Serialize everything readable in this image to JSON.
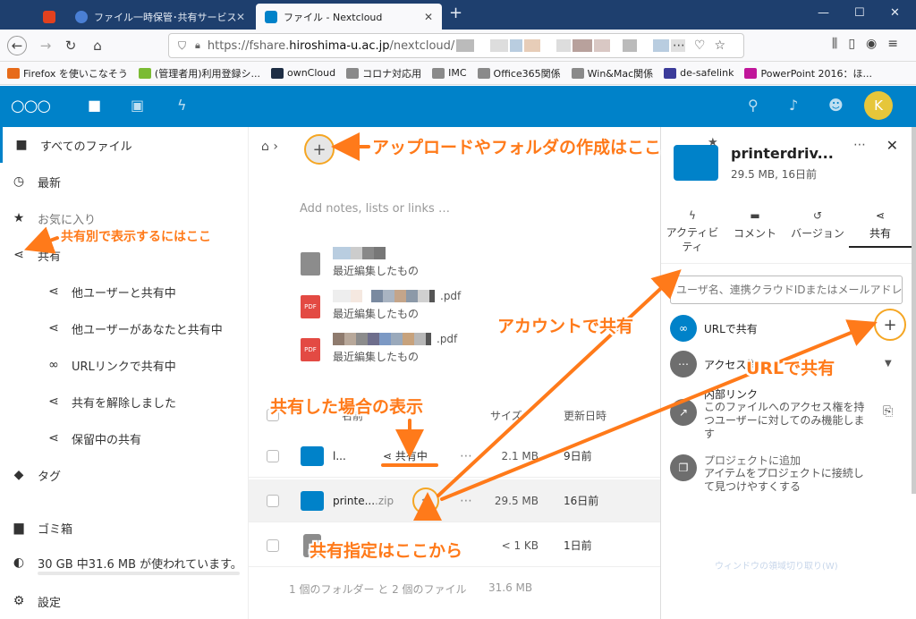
{
  "browser": {
    "tabs": [
      {
        "label": "",
        "color": "#e2411f"
      },
      {
        "label": "ファイル一時保管･共有サービス (N",
        "color": "#4a7fd4"
      },
      {
        "label": "ファイル - Nextcloud",
        "color": "#0082c9"
      }
    ],
    "new_tab": "+",
    "url_host": "https://fshare.",
    "url_domain": "hiroshima-u.ac.jp",
    "url_path": "/nextcloud/",
    "bookmarks": [
      {
        "label": "Firefox を使いこなそう",
        "color": "#e76b1a"
      },
      {
        "label": "(管理者用)利用登録シ...",
        "color": "#7bbb34"
      },
      {
        "label": "ownCloud",
        "color": "#1d2d44"
      },
      {
        "label": "コロナ対応用",
        "color": "#8a8a8a"
      },
      {
        "label": "IMC",
        "color": "#8a8a8a"
      },
      {
        "label": "Office365関係",
        "color": "#8a8a8a"
      },
      {
        "label": "Win&Mac関係",
        "color": "#8a8a8a"
      },
      {
        "label": "de-safelink",
        "color": "#3b3b9a"
      },
      {
        "label": "PowerPoint 2016：ほ...",
        "color": "#c0169a"
      }
    ]
  },
  "header": {
    "logo": "○○○",
    "avatar_letter": "K",
    "brand_color": "#0082c9"
  },
  "sidebar": {
    "items": [
      {
        "label": "すべてのファイル",
        "icon": "folder-icon"
      },
      {
        "label": "最新",
        "icon": "clock-icon"
      },
      {
        "label": "お気に入り",
        "icon": "star-icon"
      },
      {
        "label": "共有",
        "icon": "share-icon"
      },
      {
        "label": "他ユーザーと共有中",
        "icon": "share-icon"
      },
      {
        "label": "他ユーザーがあなたと共有中",
        "icon": "share-icon"
      },
      {
        "label": "URLリンクで共有中",
        "icon": "link-icon"
      },
      {
        "label": "共有を解除しました",
        "icon": "share-icon"
      },
      {
        "label": "保留中の共有",
        "icon": "share-icon"
      },
      {
        "label": "タグ",
        "icon": "tag-icon"
      },
      {
        "label": "ゴミ箱",
        "icon": "trash-icon"
      },
      {
        "label": "30 GB 中31.6 MB が使われています。",
        "icon": "pie-icon"
      },
      {
        "label": "設定",
        "icon": "gear-icon"
      }
    ]
  },
  "main": {
    "notes_placeholder": "Add notes, lists or links …",
    "recent": [
      {
        "ext": "",
        "sub": "最近編集したもの",
        "type": "doc"
      },
      {
        "ext": ".pdf",
        "sub": "最近編集したもの",
        "type": "pdf"
      },
      {
        "ext": ".pdf",
        "sub": "最近編集したもの",
        "type": "pdf"
      }
    ],
    "pdf_label": "PDF",
    "columns": {
      "name": "名前",
      "size": "サイズ",
      "modified": "更新日時"
    },
    "files": [
      {
        "name": "l...",
        "ext": "",
        "shared_label": "共有中",
        "size": "2.1 MB",
        "date": "9日前",
        "type": "folder"
      },
      {
        "name": "printe...",
        "ext": ".zip",
        "size": "29.5 MB",
        "date": "16日前",
        "type": "folder"
      },
      {
        "name": "",
        "ext": "",
        "size": "< 1 KB",
        "date": "1日前",
        "type": "doc"
      }
    ],
    "summary": "1 個のフォルダー と 2 個のファイル",
    "summary_size": "31.6 MB"
  },
  "panel": {
    "title": "printerdriv...",
    "meta": "29.5 MB, 16日前",
    "tabs": [
      {
        "label": "アクティビティ",
        "icon": "bolt-icon"
      },
      {
        "label": "コメント",
        "icon": "comment-icon"
      },
      {
        "label": "バージョン",
        "icon": "history-icon"
      },
      {
        "label": "共有",
        "icon": "share-icon"
      }
    ],
    "search_placeholder": "ユーザ名、連携クラウドIDまたはメールアドレス",
    "url_share": "URLで共有",
    "access_label": "アクセス権",
    "access_suffix": "他",
    "internal_title": "内部リンク",
    "internal_desc": "このファイルへのアクセス権を持つユーザーに対してのみ機能します",
    "project_title": "プロジェクトに追加",
    "project_desc": "アイテムをプロジェクトに接続して見つけやすくする",
    "faint_text": "ウィンドウの領域切り取り(W)"
  },
  "annotations": {
    "upload": "アップロードやフォルダの作成はここ",
    "view_shares": "共有別で表示するにはここ",
    "account_share": "アカウントで共有",
    "url_share": "URLで共有",
    "shared_display": "共有した場合の表示",
    "share_from_here": "共有指定はここから",
    "color": "#ff7a1a"
  }
}
